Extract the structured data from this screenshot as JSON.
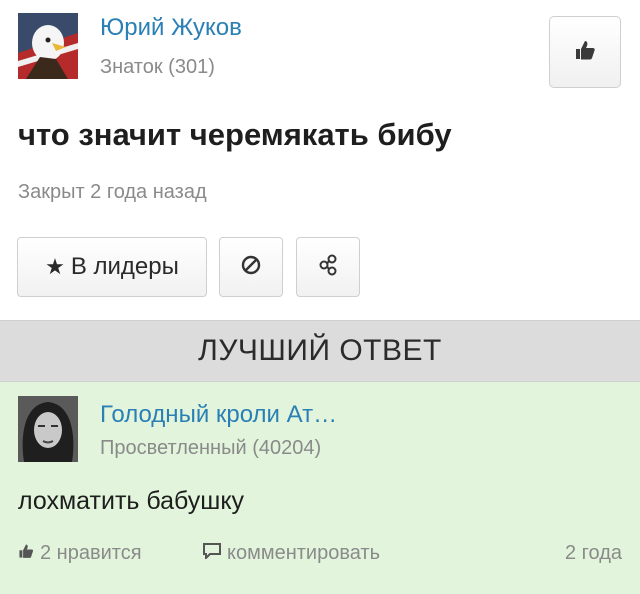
{
  "question": {
    "author_name": "Юрий Жуков",
    "author_rank": "Знаток (301)",
    "title": "что значит черемякать бибу",
    "status": "Закрыт 2 года назад",
    "actions": {
      "leaders_label": "В лидеры"
    },
    "like_icon": "thumbs-up-icon"
  },
  "best_answer": {
    "header": "ЛУЧШИЙ ОТВЕТ",
    "author_name": "Голодный кроли Ат…",
    "author_rank": "Просветленный (40204)",
    "text": "лохматить бабушку",
    "likes_label": "2 нравится",
    "comment_label": "комментировать",
    "age": "2 года"
  },
  "colors": {
    "link": "#2a7fb5",
    "muted": "#8a8a8a",
    "answer_bg": "#e2f5dc",
    "header_bar_bg": "#dcdcdc"
  }
}
